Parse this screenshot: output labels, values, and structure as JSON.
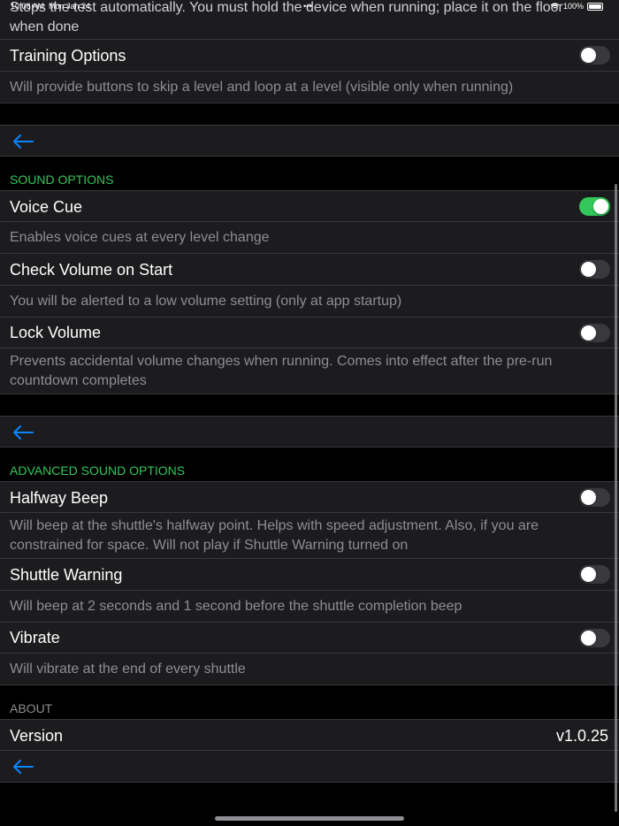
{
  "status_bar": {
    "time": "10:08 AM",
    "date": "Mon Jan 24",
    "battery": "100%"
  },
  "top_partial": {
    "desc": "Stops the test automatically. You must hold the device when running; place it on the floor when done"
  },
  "training": {
    "title": "Training Options",
    "toggle_on": false,
    "desc": "Will provide buttons to skip a level and loop at a level (visible only when running)"
  },
  "sound_options": {
    "header": "SOUND OPTIONS",
    "items": [
      {
        "title": "Voice Cue",
        "toggle_on": true,
        "desc": "Enables voice cues at every level change"
      },
      {
        "title": "Check Volume on Start",
        "toggle_on": false,
        "desc": "You will be alerted to a low volume setting (only at app startup)"
      },
      {
        "title": "Lock Volume",
        "toggle_on": false,
        "desc": "Prevents accidental volume changes when running. Comes into effect after the pre-run countdown completes"
      }
    ]
  },
  "advanced_sound_options": {
    "header": "ADVANCED SOUND OPTIONS",
    "items": [
      {
        "title": "Halfway Beep",
        "toggle_on": false,
        "desc": "Will beep at the shuttle's halfway point. Helps with speed adjustment. Also, if you are constrained for space. Will not play if Shuttle Warning turned on"
      },
      {
        "title": "Shuttle Warning",
        "toggle_on": false,
        "desc": "Will beep at 2 seconds and 1 second before the shuttle completion beep"
      },
      {
        "title": "Vibrate",
        "toggle_on": false,
        "desc": "Will vibrate at the end of every shuttle"
      }
    ]
  },
  "about": {
    "header": "ABOUT",
    "version_label": "Version",
    "version_value": "v1.0.25"
  },
  "colors": {
    "accent_green": "#34c759",
    "link_blue": "#0a84ff",
    "cell_bg": "#1c1c1e"
  },
  "icons": {
    "back": "arrow-left-icon",
    "wifi": "wifi-icon",
    "battery": "battery-icon"
  }
}
